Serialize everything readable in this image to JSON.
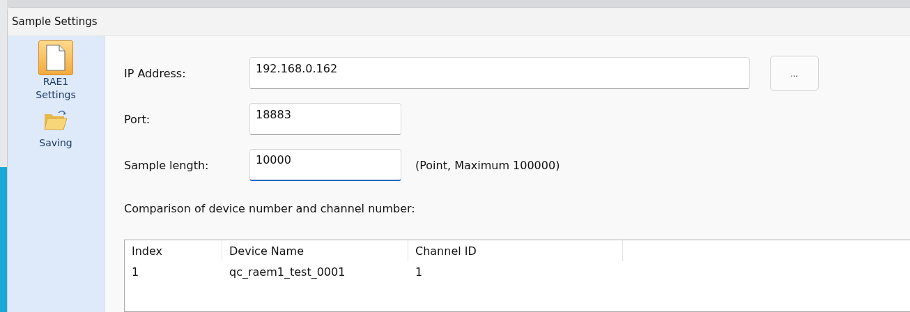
{
  "window": {
    "title": "Sample Settings"
  },
  "sidebar": {
    "items": [
      {
        "label": "RAE1\nSettings",
        "kind": "page",
        "selected": true
      },
      {
        "label": "Saving",
        "kind": "folder",
        "selected": false
      }
    ]
  },
  "form": {
    "ip": {
      "label": "IP Address:",
      "value": "192.168.0.162",
      "button": "..."
    },
    "port": {
      "label": "Port:",
      "value": "18883",
      "focused": false
    },
    "sample_length": {
      "label": "Sample length:",
      "value": "10000",
      "focused": true,
      "hint": "(Point, Maximum 100000)"
    }
  },
  "table": {
    "caption": "Comparison of device number and channel number:",
    "columns": [
      "Index",
      "Device Name",
      "Channel ID"
    ],
    "rows": [
      [
        "1",
        "qc_raem1_test_0001",
        "1"
      ]
    ]
  }
}
